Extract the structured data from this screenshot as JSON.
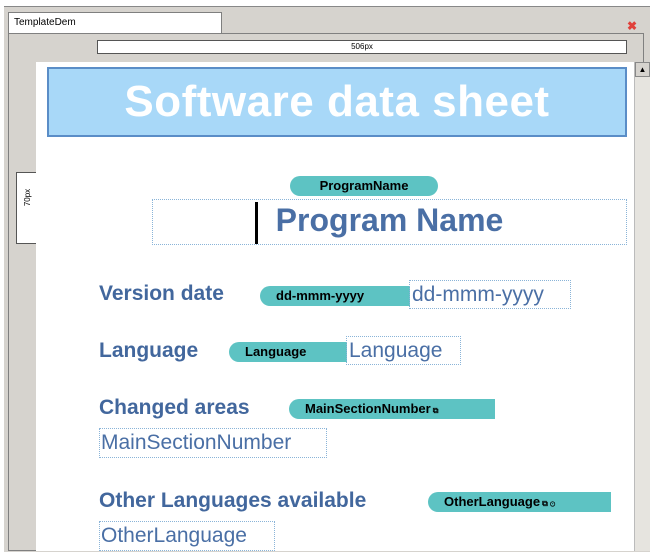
{
  "window": {
    "tab_label": "TemplateDem"
  },
  "rulers": {
    "horizontal_label": "506px",
    "vertical_label": "70px"
  },
  "banner": {
    "title": "Software data sheet"
  },
  "program": {
    "tag": "ProgramName",
    "value": "Program Name"
  },
  "fields": [
    {
      "label": "Version date",
      "tag": "dd-mmm-yyyy",
      "value": "dd-mmm-yyyy"
    },
    {
      "label": "Language",
      "tag": "Language",
      "value": "Language"
    },
    {
      "label": "Changed areas",
      "tag": "MainSectionNumber",
      "tag_suffix": "⧉",
      "value": "MainSectionNumber"
    },
    {
      "label": "Other Languages available",
      "tag": "OtherLanguage",
      "tag_suffix": "⧉ ⊙",
      "value": "OtherLanguage"
    }
  ],
  "colors": {
    "banner_bg": "#a8d8f8",
    "tag_bg": "#5dc3c3",
    "label": "#42679d"
  },
  "icons": {
    "close": "close-icon",
    "scroll_up": "arrow-up-icon"
  }
}
